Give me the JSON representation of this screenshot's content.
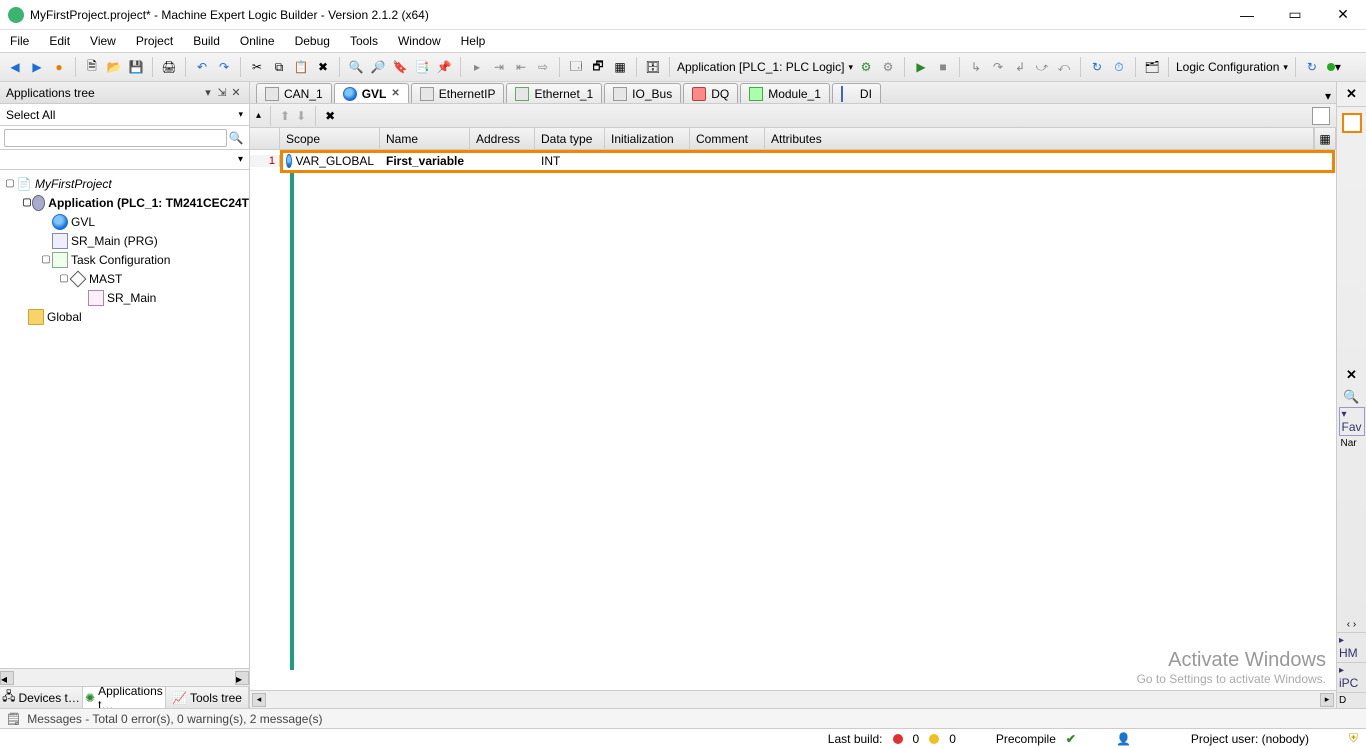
{
  "title": "MyFirstProject.project* - Machine Expert Logic Builder - Version 2.1.2 (x64)",
  "menu": [
    "File",
    "Edit",
    "View",
    "Project",
    "Build",
    "Online",
    "Debug",
    "Tools",
    "Window",
    "Help"
  ],
  "toolbar": {
    "app_context": "Application [PLC_1: PLC Logic]",
    "logic_config": "Logic Configuration"
  },
  "left_panel": {
    "title": "Applications tree",
    "select_all": "Select All",
    "search_placeholder": ""
  },
  "tree": {
    "root": "MyFirstProject",
    "app": "Application (PLC_1: TM241CEC24T",
    "gvl": "GVL",
    "sr_main_prg": "SR_Main (PRG)",
    "task_cfg": "Task Configuration",
    "mast": "MAST",
    "sr_main": "SR_Main",
    "global": "Global"
  },
  "left_tabs": {
    "devices": "Devices t…",
    "applications": "Applications t…",
    "tools": "Tools tree"
  },
  "tabs": [
    {
      "label": "CAN_1",
      "icon": "chip"
    },
    {
      "label": "GVL",
      "icon": "globe",
      "active": true
    },
    {
      "label": "EthernetIP",
      "icon": "chip"
    },
    {
      "label": "Ethernet_1",
      "icon": "eth"
    },
    {
      "label": "IO_Bus",
      "icon": "chip"
    },
    {
      "label": "DQ",
      "icon": "dq"
    },
    {
      "label": "Module_1",
      "icon": "mod"
    },
    {
      "label": "DI",
      "icon": "di"
    }
  ],
  "grid": {
    "headers": {
      "scope": "Scope",
      "name": "Name",
      "address": "Address",
      "type": "Data type",
      "init": "Initialization",
      "comment": "Comment",
      "attr": "Attributes"
    },
    "rows": [
      {
        "n": "1",
        "scope": "VAR_GLOBAL",
        "name": "First_variable",
        "addr": "",
        "type": "INT",
        "init": "",
        "comment": "",
        "attr": ""
      }
    ]
  },
  "right": {
    "fav": "Fav",
    "nar": "Nar",
    "hm": "HM",
    "ipc": "iPC",
    "d": "D"
  },
  "messages": "Messages - Total 0 error(s), 0 warning(s), 2 message(s)",
  "status": {
    "lastbuild": "Last build:",
    "err": "0",
    "warn": "0",
    "precompile": "Precompile",
    "project_user": "Project user: (nobody)"
  },
  "watermark": {
    "big": "Activate Windows",
    "small": "Go to Settings to activate Windows."
  }
}
